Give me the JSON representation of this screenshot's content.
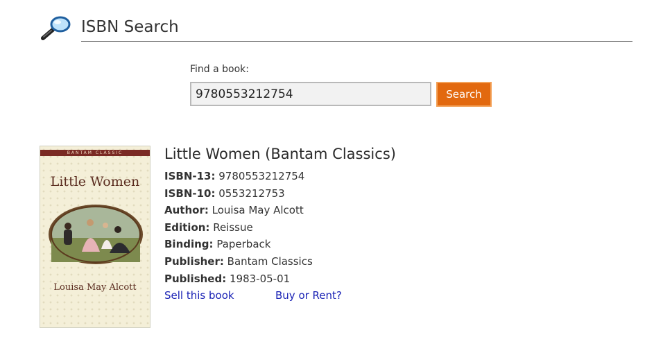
{
  "header": {
    "title": "ISBN Search",
    "icon": "magnifying-glass-icon"
  },
  "search": {
    "label": "Find a book:",
    "value": "9780553212754",
    "button_label": "Search",
    "button_color": "#e2690f"
  },
  "book": {
    "title": "Little Women (Bantam Classics)",
    "cover": {
      "series_band": "BANTAM CLASSIC",
      "title": "Little Women",
      "author": "Louisa May Alcott"
    },
    "fields": [
      {
        "label": "ISBN-13:",
        "value": "9780553212754"
      },
      {
        "label": "ISBN-10:",
        "value": "0553212753"
      },
      {
        "label": "Author:",
        "value": "Louisa May Alcott"
      },
      {
        "label": "Edition:",
        "value": "Reissue"
      },
      {
        "label": "Binding:",
        "value": "Paperback"
      },
      {
        "label": "Publisher:",
        "value": "Bantam Classics"
      },
      {
        "label": "Published:",
        "value": "1983-05-01"
      }
    ],
    "links": {
      "sell": "Sell this book",
      "buy": "Buy or Rent?",
      "link_color": "#1a22b5"
    }
  }
}
